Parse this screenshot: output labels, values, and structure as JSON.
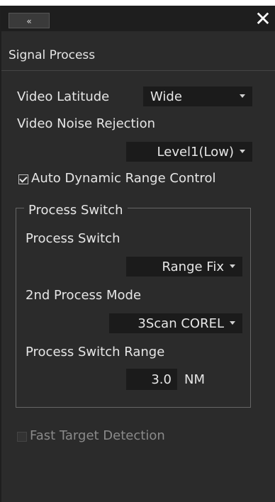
{
  "titlebar": {
    "collapse_label": "«",
    "close_label": "✕"
  },
  "panel": {
    "title": "Signal Process"
  },
  "video_latitude": {
    "label": "Video Latitude",
    "value": "Wide"
  },
  "video_noise_rejection": {
    "label": "Video Noise Rejection",
    "value": "Level1(Low)"
  },
  "adrc": {
    "label": "Auto Dynamic Range Control",
    "checked": true
  },
  "process_switch_group": {
    "title": "Process Switch",
    "process_switch": {
      "label": "Process Switch",
      "value": "Range Fix"
    },
    "second_mode": {
      "label": "2nd Process Mode",
      "value": "3Scan COREL"
    },
    "range": {
      "label": "Process Switch Range",
      "value": "3.0",
      "unit": "NM"
    }
  },
  "fast_target": {
    "label": "Fast Target Detection",
    "checked": false,
    "enabled": false
  }
}
